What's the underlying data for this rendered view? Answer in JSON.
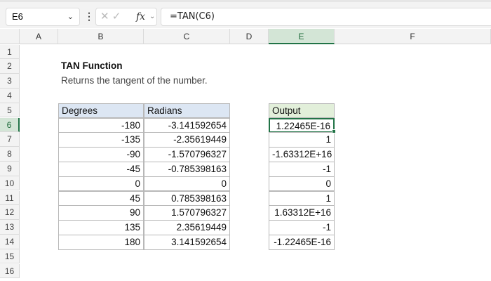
{
  "name_box": "E6",
  "formula": "=TAN(C6)",
  "formula_icons": {
    "cancel": "✕",
    "enter": "✓",
    "fx": "fx"
  },
  "columns": [
    "A",
    "B",
    "C",
    "D",
    "E",
    "F"
  ],
  "selected_column": "E",
  "selected_row": 6,
  "rows": [
    "1",
    "2",
    "3",
    "4",
    "5",
    "6",
    "7",
    "8",
    "9",
    "10",
    "11",
    "12",
    "13",
    "14",
    "15",
    "16"
  ],
  "title": "TAN Function",
  "subtitle": "Returns the tangent of the number.",
  "table": {
    "headers": [
      "Degrees",
      "Radians"
    ],
    "degrees": [
      "-180",
      "-135",
      "-90",
      "-45",
      "0",
      "45",
      "90",
      "135",
      "180"
    ],
    "radians": [
      "-3.141592654",
      "-2.35619449",
      "-1.570796327",
      "-0.785398163",
      "0",
      "0.785398163",
      "1.570796327",
      "2.35619449",
      "3.141592654"
    ]
  },
  "output": {
    "header": "Output",
    "values": [
      "1.22465E-16",
      "1",
      "-1.63312E+16",
      "-1",
      "0",
      "1",
      "1.63312E+16",
      "-1",
      "-1.22465E-16"
    ]
  },
  "colors": {
    "accent": "#217346",
    "header_blue": "#dce6f3",
    "header_green": "#e2efda"
  }
}
